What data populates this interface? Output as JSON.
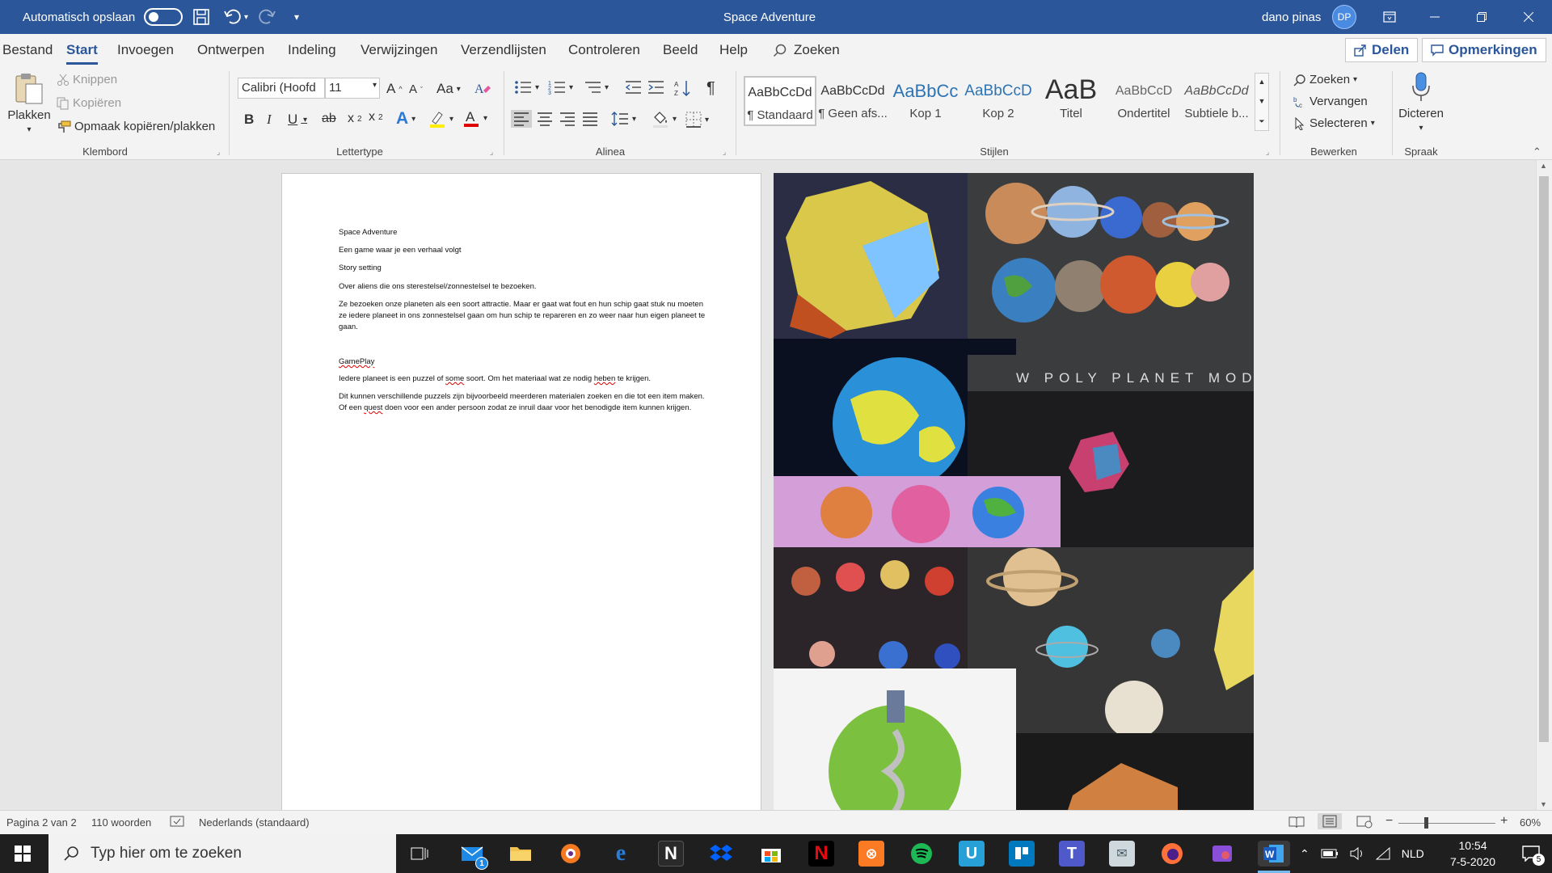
{
  "titlebar": {
    "autosave_label": "Automatisch opslaan",
    "doc_title": "Space Adventure",
    "user_name": "dano pinas",
    "user_initials": "DP"
  },
  "tabs": [
    "Bestand",
    "Start",
    "Invoegen",
    "Ontwerpen",
    "Indeling",
    "Verwijzingen",
    "Verzendlijsten",
    "Controleren",
    "Beeld",
    "Help"
  ],
  "active_tab": "Start",
  "search_label": "Zoeken",
  "share_label": "Delen",
  "comments_label": "Opmerkingen",
  "ribbon": {
    "clipboard": {
      "paste": "Plakken",
      "cut": "Knippen",
      "copy": "Kopiëren",
      "format_painter": "Opmaak kopiëren/plakken",
      "group": "Klembord"
    },
    "font": {
      "name": "Calibri (Hoofd",
      "size": "11",
      "group": "Lettertype"
    },
    "paragraph": {
      "group": "Alinea"
    },
    "styles": {
      "items": [
        {
          "preview": "AaBbCcDd",
          "name": "¶ Standaard"
        },
        {
          "preview": "AaBbCcDd",
          "name": "¶ Geen afs..."
        },
        {
          "preview": "AaBbCc",
          "name": "Kop 1"
        },
        {
          "preview": "AaBbCcD",
          "name": "Kop 2"
        },
        {
          "preview": "AaB",
          "name": "Titel"
        },
        {
          "preview": "AaBbCcD",
          "name": "Ondertitel"
        },
        {
          "preview": "AaBbCcDd",
          "name": "Subtiele b..."
        }
      ],
      "group": "Stijlen"
    },
    "editing": {
      "find": "Zoeken",
      "replace": "Vervangen",
      "select": "Selecteren",
      "group": "Bewerken"
    },
    "voice": {
      "dictate": "Dicteren",
      "group": "Spraak"
    }
  },
  "document": {
    "lines": [
      "Space Adventure",
      " Een game waar je een verhaal volgt",
      "Story  setting",
      "Over aliens die ons sterestelsel/zonnestelsel te bezoeken.",
      "Ze bezoeken onze planeten als een soort attractie. Maar er gaat wat fout en hun schip gaat stuk nu moeten ze iedere planeet in ons zonnestelsel gaan om hun schip te repareren en zo weer naar hun eigen planeet te gaan."
    ],
    "gameplay_heading": "GamePlay",
    "gameplay_1_pre": "Iedere planeet is een puzzel of  ",
    "gameplay_1_err1": "some",
    "gameplay_1_mid": " soort. Om het materiaal wat ze nodig ",
    "gameplay_1_err2": "heben",
    "gameplay_1_post": " te krijgen.",
    "gameplay_2_pre": "Dit kunnen verschillende puzzels zijn bijvoorbeeld  meerderen materialen zoeken en die tot een item maken. Of  een ",
    "gameplay_2_err": "quest",
    "gameplay_2_post": " doen voor een ander persoon zodat ze inruil daar voor het benodigde item kunnen krijgen."
  },
  "image_banner": "W POLY PLANET MODELS",
  "statusbar": {
    "page": "Pagina 2 van 2",
    "words": "110 woorden",
    "language": "Nederlands (standaard)",
    "zoom": "60%"
  },
  "taskbar": {
    "search_placeholder": "Typ hier om te zoeken",
    "mail_badge": "1",
    "lang": "NLD",
    "time": "10:54",
    "date": "7-5-2020",
    "notif_badge": "5"
  },
  "colors": {
    "word_blue": "#2b579a",
    "taskbar": "#1f1f1f"
  }
}
